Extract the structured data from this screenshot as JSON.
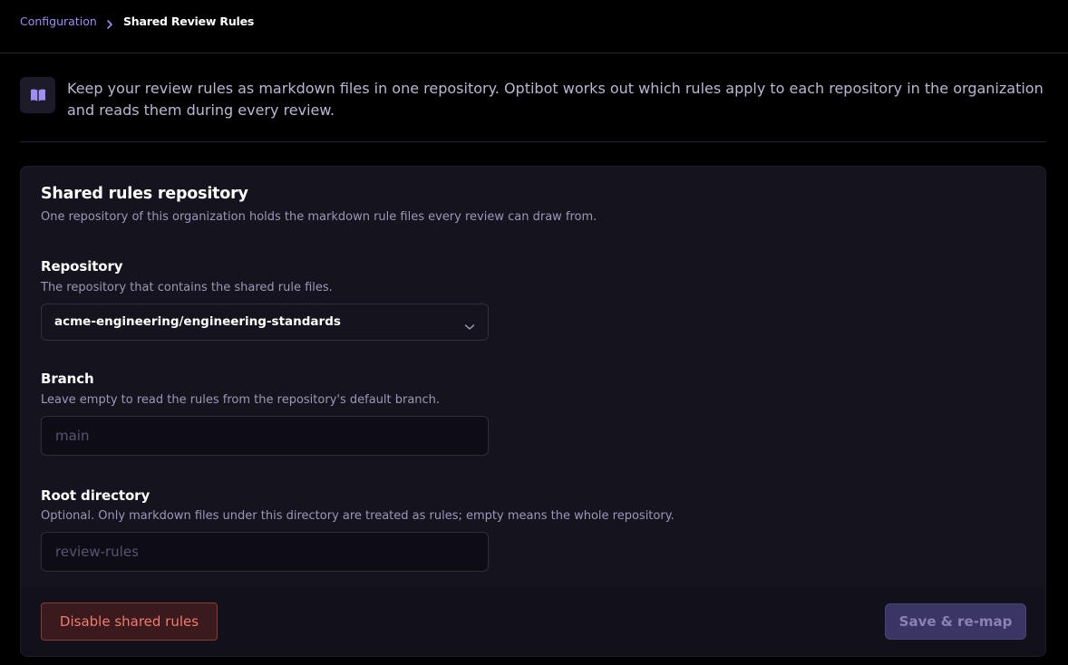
{
  "breadcrumb": {
    "parent": "Configuration",
    "current": "Shared Review Rules"
  },
  "intro": {
    "icon": "book-open-icon",
    "text": "Keep your review rules as markdown files in one repository. Optibot works out which rules apply to each repository in the organization and reads them during every review."
  },
  "card": {
    "title": "Shared rules repository",
    "description": "One repository of this organization holds the markdown rule files every review can draw from."
  },
  "fields": {
    "repository": {
      "label": "Repository",
      "help": "The repository that contains the shared rule files.",
      "value": "acme-engineering/engineering-standards"
    },
    "branch": {
      "label": "Branch",
      "help": "Leave empty to read the rules from the repository's default branch.",
      "value": "",
      "placeholder": "main"
    },
    "root_directory": {
      "label": "Root directory",
      "help": "Optional. Only markdown files under this directory are treated as rules; empty means the whole repository.",
      "value": "",
      "placeholder": "review-rules"
    }
  },
  "actions": {
    "disable_label": "Disable shared rules",
    "save_label": "Save & re-map"
  },
  "colors": {
    "accent": "#9d8ef2",
    "danger": "#f27a6e",
    "primary_disabled": "#3b3565"
  }
}
